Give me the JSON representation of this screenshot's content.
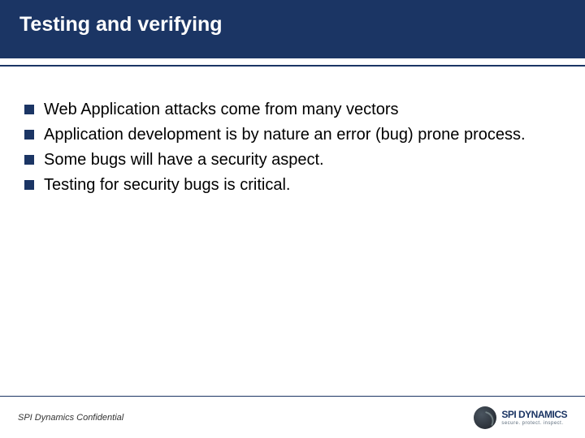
{
  "header": {
    "title": "Testing and verifying"
  },
  "bullets": [
    {
      "text": "Web Application attacks come from many vectors"
    },
    {
      "text": "Application development is by nature an error (bug) prone process."
    },
    {
      "text": "Some bugs will have a security aspect."
    },
    {
      "text": "Testing for security bugs is critical."
    }
  ],
  "footer": {
    "confidential": "SPI Dynamics Confidential",
    "logo_name": "SPI DYNAMICS",
    "logo_tag": "secure. protect. inspect."
  }
}
